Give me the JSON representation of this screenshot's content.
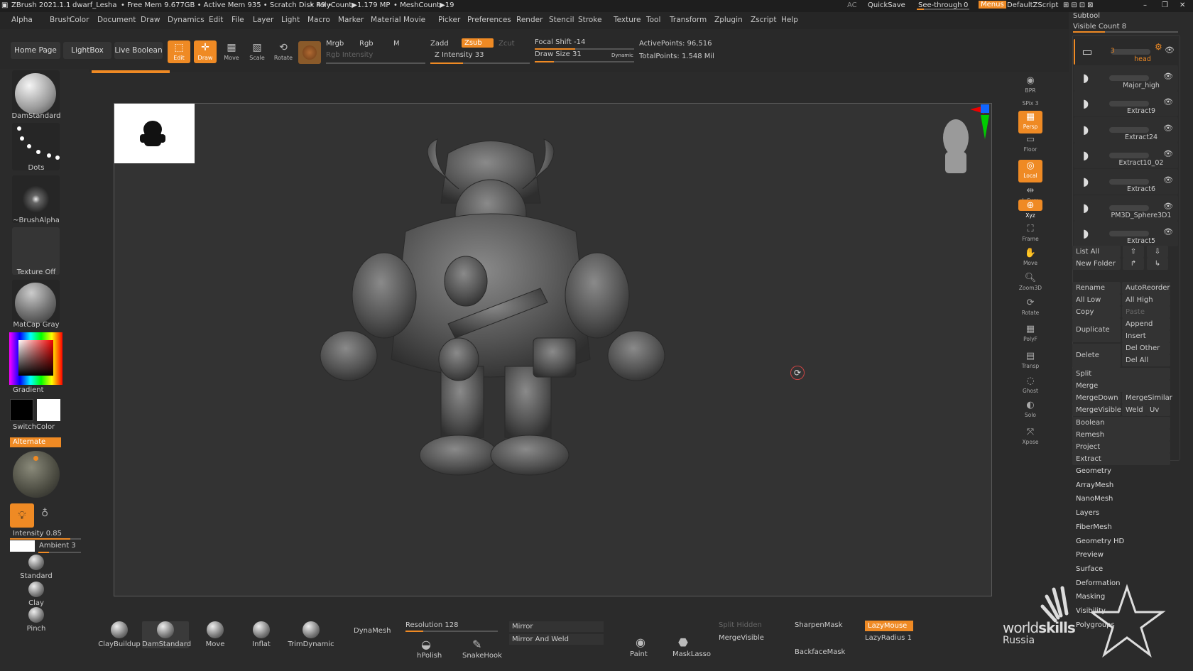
{
  "titlebar": {
    "app": "ZBrush 2021.1.1",
    "user": "dwarf_Lesha",
    "stats": "• Free Mem 9.677GB • Active Mem 935 • Scratch Disk 49 •",
    "polycount": "• PolyCount▶1.179 MP",
    "meshcount": "• MeshCount▶19",
    "ac": "AC",
    "quicksave": "QuickSave",
    "seethrough": "See-through",
    "seethrough_val": "0",
    "menus": "Menus",
    "script": "DefaultZScript"
  },
  "menus": [
    "Alpha",
    "Brush",
    "Color",
    "Document",
    "Draw",
    "Dynamics",
    "Edit",
    "File",
    "Layer",
    "Light",
    "Macro",
    "Marker",
    "Material",
    "Movie",
    "Picker",
    "Preferences",
    "Render",
    "Stencil",
    "Stroke",
    "Texture",
    "Tool",
    "Transform",
    "Zplugin",
    "Zscript",
    "Help"
  ],
  "toolbar": {
    "home": "Home Page",
    "lightbox": "LightBox",
    "liveboolean": "Live Boolean",
    "edit": "Edit",
    "draw": "Draw",
    "move": "Move",
    "scale": "Scale",
    "rotate": "Rotate",
    "mrgb": "Mrgb",
    "rgb": "Rgb",
    "m": "M",
    "rgb_intensity": "Rgb Intensity",
    "zadd": "Zadd",
    "zsub": "Zsub",
    "zcut": "Zcut",
    "z_intensity": "Z Intensity 33",
    "focal_shift": "Focal Shift -14",
    "draw_size": "Draw Size 31",
    "dynamic": "Dynamic",
    "active_points": "ActivePoints: 96,516",
    "total_points": "TotalPoints: 1.548 Mil"
  },
  "left": {
    "brush": "DamStandard",
    "stroke": "Dots",
    "alpha": "~BrushAlpha",
    "texture": "Texture Off",
    "material": "MatCap Gray",
    "gradient": "Gradient",
    "switchcolor": "SwitchColor",
    "alternate": "Alternate",
    "intensity": "Intensity 0.85",
    "ambient": "Ambient 3",
    "brushes": [
      "Standard",
      "Clay",
      "Pinch"
    ]
  },
  "rightshelf": [
    "BPR",
    "SPix 3",
    "Persp",
    "Floor",
    "Local",
    "L.Sym",
    "Xyz",
    "Frame",
    "Move",
    "Zoom3D",
    "Rotate",
    "PolyF",
    "Transp",
    "Ghost",
    "Solo",
    "Xpose"
  ],
  "subtool": {
    "title": "Subtool",
    "visible_count": "Visible Count 8",
    "items": [
      {
        "name": "head",
        "badge": "3"
      },
      {
        "name": "Major_high"
      },
      {
        "name": "Extract9"
      },
      {
        "name": "Extract24"
      },
      {
        "name": "Extract10_02"
      },
      {
        "name": "Extract6"
      },
      {
        "name": "PM3D_Sphere3D1"
      },
      {
        "name": "Extract5"
      }
    ],
    "list_all": "List All",
    "new_folder": "New Folder",
    "rename": "Rename",
    "autoreorder": "AutoReorder",
    "all_low": "All Low",
    "all_high": "All High",
    "copy": "Copy",
    "paste": "Paste",
    "duplicate": "Duplicate",
    "append": "Append",
    "insert": "Insert",
    "delete": "Delete",
    "del_other": "Del Other",
    "del_all": "Del All",
    "split": "Split",
    "merge": "Merge",
    "mergedown": "MergeDown",
    "mergesimilar": "MergeSimilar",
    "mergevisible": "MergeVisible",
    "weld": "Weld",
    "uv": "Uv",
    "boolean": "Boolean",
    "remesh": "Remesh",
    "project": "Project",
    "extract": "Extract",
    "panels": [
      "Geometry",
      "ArrayMesh",
      "NanoMesh",
      "Layers",
      "FiberMesh",
      "Geometry HD",
      "Preview",
      "Surface",
      "Deformation",
      "Masking",
      "Visibility",
      "Polygroups"
    ]
  },
  "bottom": {
    "brushes": [
      "ClayBuildup",
      "DamStandard",
      "Move",
      "Inflat",
      "TrimDynamic"
    ],
    "dynamesh": "DynaMesh",
    "resolution": "Resolution 128",
    "hpolish": "hPolish",
    "snakehook": "SnakeHook",
    "mirror": "Mirror",
    "mirror_weld": "Mirror And Weld",
    "paint": "Paint",
    "masklasso": "MaskLasso",
    "split_hidden": "Split Hidden",
    "mergevisible": "MergeVisible",
    "sharpenmask": "SharpenMask",
    "backfacemask": "BackfaceMask",
    "lazymouse": "LazyMouse",
    "lazyradius": "LazyRadius 1"
  },
  "watermark": {
    "line1": "world",
    "line2": "skills",
    "line3": "Russia"
  },
  "colors": {
    "accent": "#ef8a24",
    "bg": "#2b2b2b"
  }
}
